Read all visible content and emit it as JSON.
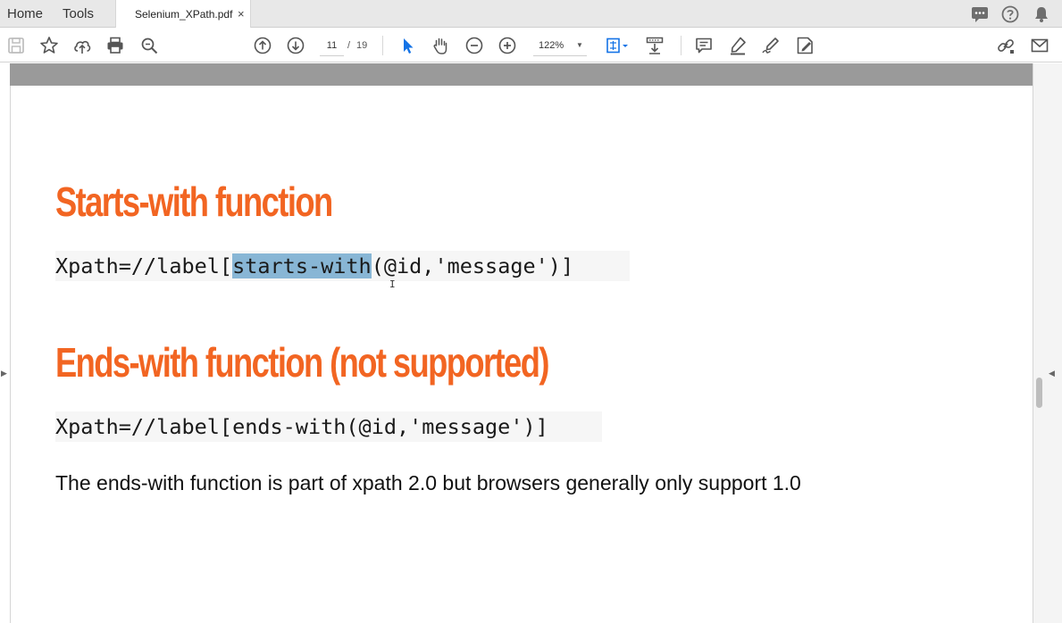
{
  "tabbar": {
    "home_label": "Home",
    "tools_label": "Tools",
    "document_tab_label": "Selenium_XPath.pdf",
    "close_glyph": "×",
    "right_icons": [
      "chat-icon",
      "help-icon",
      "notification-bell-icon"
    ]
  },
  "toolbar": {
    "current_page": "11",
    "page_separator": "/",
    "total_pages": "19",
    "zoom_level": "122%",
    "icons": [
      "save-icon",
      "bookmark-star-icon",
      "cloud-upload-icon",
      "print-icon",
      "zoom-search-icon",
      "previous-page-icon",
      "next-page-icon",
      "select-cursor-icon",
      "hand-pan-icon",
      "zoom-out-icon",
      "zoom-in-icon",
      "fit-page-icon",
      "scroll-mode-icon",
      "comment-icon",
      "highlight-pen-icon",
      "sign-icon",
      "fill-sign-icon",
      "share-link-icon",
      "email-icon"
    ]
  },
  "document": {
    "heading_1": "Starts-with function",
    "code_1_prefix": "Xpath=//label[",
    "code_1_highlight": "starts-with",
    "code_1_suffix": "(@id,'message')]",
    "heading_2": "Ends-with function (not supported)",
    "code_2": "Xpath=//label[ends-with(@id,'message')]",
    "body_text": "The ends-with function is part of xpath 2.0 but browsers generally only support 1.0",
    "cursor_glyph": "I"
  },
  "colors": {
    "heading": "#f26522",
    "selection_highlight": "#88b6d5",
    "code_background": "#f6f6f6",
    "accent_blue": "#1473e6"
  }
}
